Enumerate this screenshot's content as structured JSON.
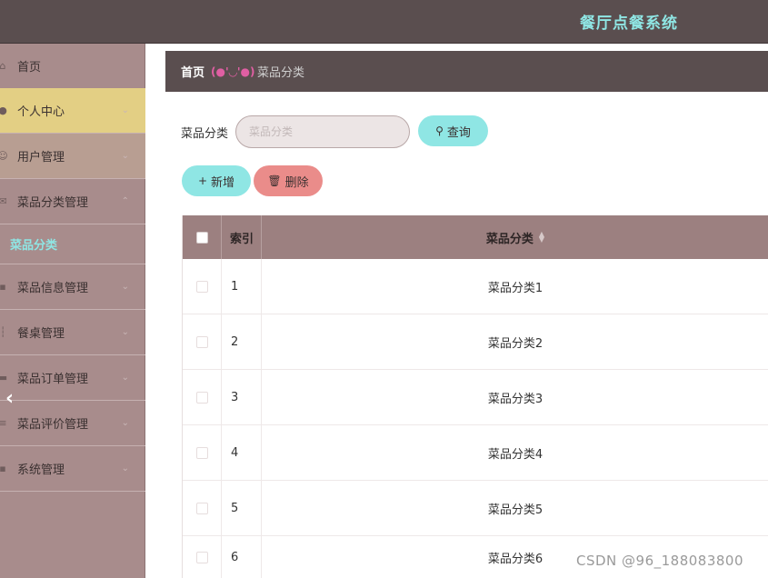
{
  "header": {
    "title": "餐厅点餐系统"
  },
  "sidebar": {
    "items": [
      {
        "label": "首页",
        "icon": "home-icon"
      },
      {
        "label": "个人中心",
        "icon": "person-icon"
      },
      {
        "label": "用户管理",
        "icon": "users-icon"
      },
      {
        "label": "菜品分类管理",
        "icon": "mail-icon"
      },
      {
        "label": "菜品分类",
        "sub": true
      },
      {
        "label": "菜品信息管理",
        "icon": "chat-icon"
      },
      {
        "label": "餐桌管理",
        "icon": "table-icon"
      },
      {
        "label": "菜品订单管理",
        "icon": "order-icon"
      },
      {
        "label": "菜品评价管理",
        "icon": "list-icon"
      },
      {
        "label": "系统管理",
        "icon": "chat-icon"
      }
    ],
    "collapse_arrow": "‹"
  },
  "breadcrumb": {
    "home": "首页",
    "separator": "(●'◡'●)",
    "current": "菜品分类"
  },
  "search": {
    "label": "菜品分类",
    "placeholder": "菜品分类",
    "query_button": "查询"
  },
  "actions": {
    "add_button": "新增",
    "delete_button": "删除"
  },
  "table": {
    "columns": [
      "索引",
      "菜品分类"
    ],
    "rows": [
      {
        "index": "1",
        "name": "菜品分类1"
      },
      {
        "index": "2",
        "name": "菜品分类2"
      },
      {
        "index": "3",
        "name": "菜品分类3"
      },
      {
        "index": "4",
        "name": "菜品分类4"
      },
      {
        "index": "5",
        "name": "菜品分类5"
      },
      {
        "index": "6",
        "name": "菜品分类6"
      }
    ]
  },
  "watermark": "CSDN @96_188083800",
  "colors": {
    "header_bg": "#5a4e4f",
    "sidebar_bg": "#a88c8c",
    "accent_cyan": "#8fe6e4",
    "accent_yellow": "#e3cf84",
    "delete_red": "#ea8c8a",
    "table_head_bg": "#9c8080"
  }
}
